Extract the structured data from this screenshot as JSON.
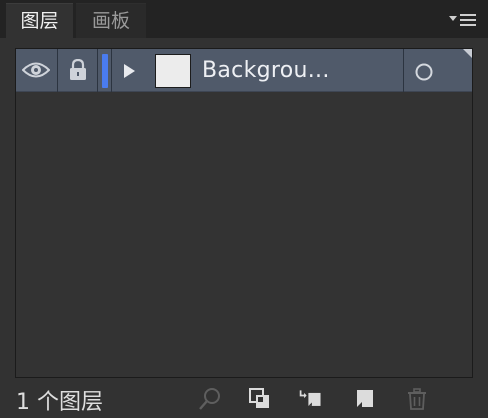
{
  "tabs": [
    {
      "label": "图层",
      "active": true
    },
    {
      "label": "画板",
      "active": false
    }
  ],
  "flyout_icon": "panel-menu-icon",
  "layers": [
    {
      "name": "Backgrou...",
      "visible": true,
      "locked": true,
      "color": "#4a7cf0",
      "icons": {
        "visibility": "eye-icon",
        "lock": "lock-icon",
        "expand": "expand-triangle-icon",
        "target": "target-circle-icon"
      }
    }
  ],
  "footer": {
    "count_label": "1 个图层",
    "icons": [
      "locate-object-icon",
      "make-clipping-mask-icon",
      "create-sublayer-icon",
      "create-new-layer-icon",
      "delete-icon"
    ]
  },
  "colors": {
    "panel_bg": "#323232",
    "tabbar_bg": "#232323",
    "row_selected": "#505a6a",
    "layer_color": "#4a7cf0"
  }
}
